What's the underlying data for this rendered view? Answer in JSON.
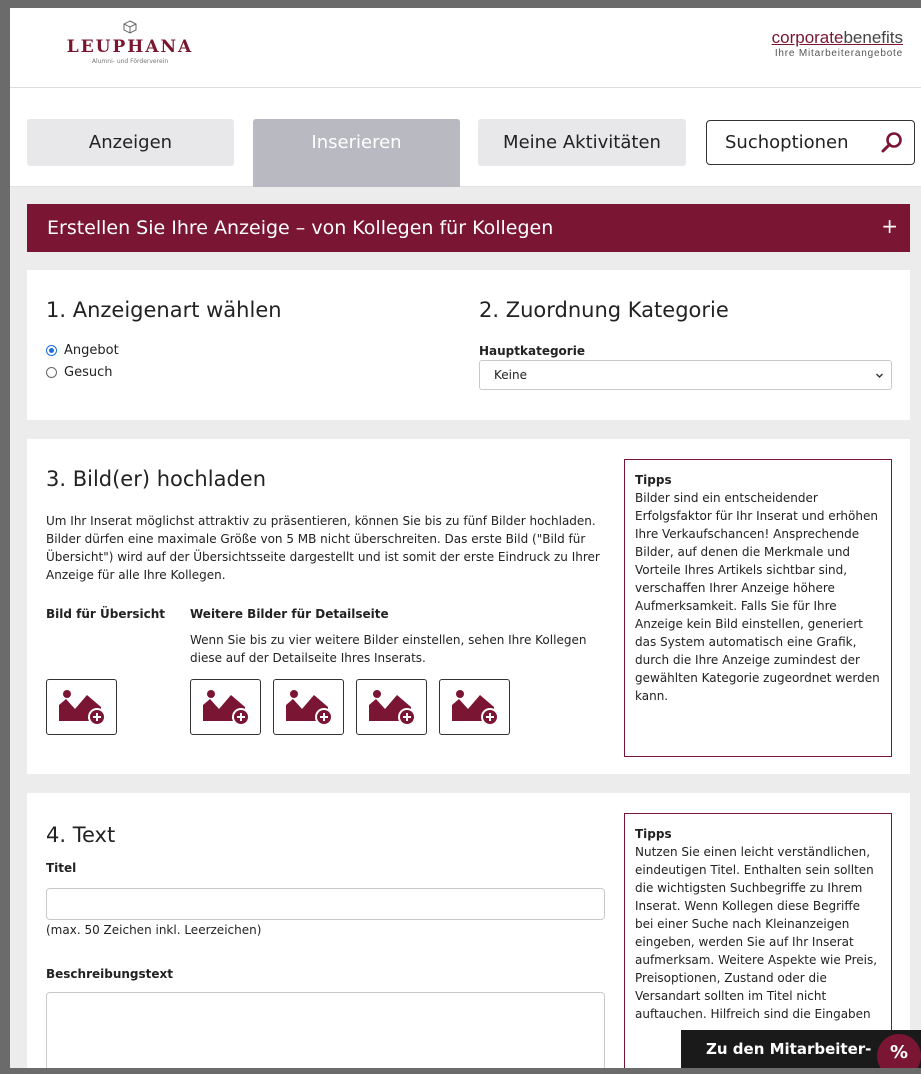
{
  "header": {
    "logo_name": "LEUPHANA",
    "logo_sub": "Alumni- und Förderverein",
    "cb_part1": "corporate",
    "cb_part2": "benefits",
    "cb_sub": "Ihre Mitarbeiterangebote"
  },
  "tabs": {
    "anzeigen": "Anzeigen",
    "inserieren": "Inserieren",
    "aktivitaeten": "Meine Aktivitäten",
    "search": "Suchoptionen"
  },
  "banner": {
    "title": "Erstellen Sie Ihre Anzeige – von Kollegen für Kollegen",
    "toggle": "+"
  },
  "section1": {
    "heading": "1. Anzeigenart wählen",
    "options": [
      "Angebot",
      "Gesuch"
    ],
    "selected": "Angebot"
  },
  "section2": {
    "heading": "2. Zuordnung Kategorie",
    "label": "Hauptkategorie",
    "value": "Keine"
  },
  "section3": {
    "heading": "3. Bild(er) hochladen",
    "intro": "Um Ihr Inserat möglichst attraktiv zu präsentieren, können Sie bis zu fünf Bilder hochladen. Bilder dürfen eine maximale Größe von 5 MB nicht überschreiten. Das erste Bild (\"Bild für Übersicht\") wird auf der Übersichtsseite dargestellt und ist somit der erste Eindruck zu Ihrer Anzeige für alle Ihre Kollegen.",
    "overview_label": "Bild für Übersicht",
    "detail_label": "Weitere Bilder für Detailseite",
    "detail_text": "Wenn Sie bis zu vier weitere Bilder einstellen, sehen Ihre Kollegen diese auf der Detailseite Ihres Inserats.",
    "tips_title": "Tipps",
    "tips_text": "Bilder sind ein entscheidender Erfolgsfaktor für Ihr Inserat und erhöhen Ihre Verkaufschancen! Ansprechende Bilder, auf denen die Merkmale und Vorteile Ihres Artikels sichtbar sind, verschaffen Ihrer Anzeige höhere Aufmerksamkeit. Falls Sie für Ihre Anzeige kein Bild einstellen, generiert das System automatisch eine Grafik, durch die Ihre Anzeige zumindest der gewählten Kategorie zugeordnet werden kann."
  },
  "section4": {
    "heading": "4. Text",
    "title_label": "Titel",
    "title_value": "",
    "title_hint": "(max. 50 Zeichen inkl. Leerzeichen)",
    "desc_label": "Beschreibungstext",
    "desc_value": "",
    "tips_title": "Tipps",
    "tips_text": "Nutzen Sie einen leicht verständlichen, eindeutigen Titel. Enthalten sein sollten die wichtigsten Suchbegriffe zu Ihrem Inserat. Wenn Kollegen diese Begriffe bei einer Suche nach Kleinanzeigen eingeben, werden Sie auf Ihr Inserat aufmerksam. Weitere Aspekte wie Preis, Preisoptionen, Zustand oder die Versandart sollten im Titel nicht auftauchen. Hilfreich sind die Eingaben"
  },
  "floating": {
    "label": "Zu den Mitarbeiter-",
    "badge": "%"
  },
  "colors": {
    "brand": "#7a1534",
    "tab_active": "#b9b9c1",
    "radio": "#1e6fd9"
  }
}
